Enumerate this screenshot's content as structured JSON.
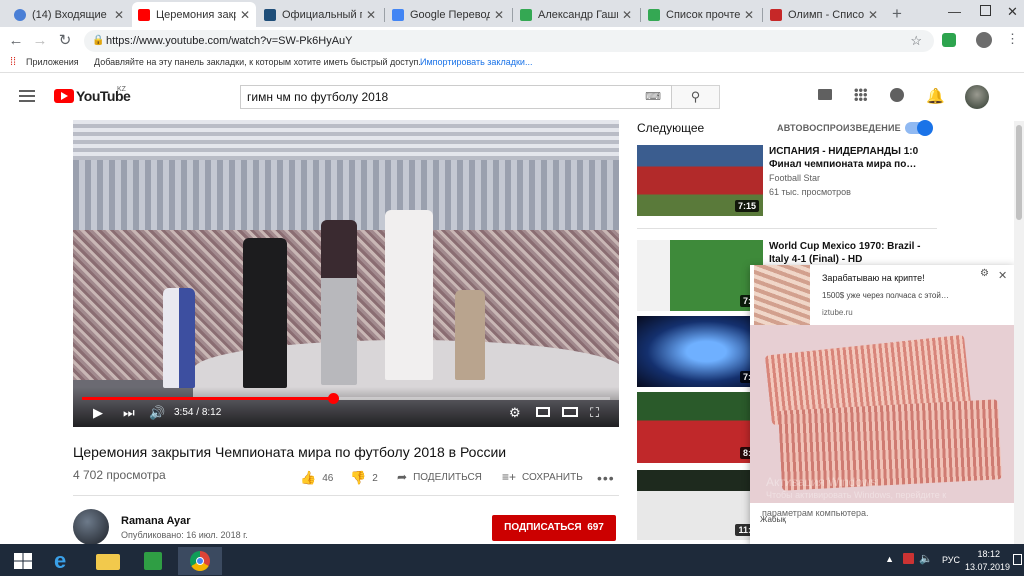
{
  "tabs": [
    {
      "title": "(14) Входящие - П",
      "color": "#d93025"
    },
    {
      "title": "Церемония закры",
      "color": "#ff0000"
    },
    {
      "title": "Официальный гим",
      "color": "#1f4e79"
    },
    {
      "title": "Google Переводчи",
      "color": "#4285f4"
    },
    {
      "title": "Александр Гашин",
      "color": "#34a853"
    },
    {
      "title": "Список прочтени",
      "color": "#34a853"
    },
    {
      "title": "Олимп - Список с",
      "color": "#c62828"
    }
  ],
  "address": {
    "url": "https://www.youtube.com/watch?v=SW-Pk6HyAuY"
  },
  "bookmarks": {
    "apps": "Приложения",
    "hint": "Добавляйте на эту панель закладки, к которым хотите иметь быстрый доступ.",
    "import": "Импортировать закладки..."
  },
  "yt": {
    "logo": "YouTube",
    "region": "KZ",
    "search_value": "гимн чм по футболу 2018"
  },
  "player": {
    "current_time": "3:54",
    "duration": "8:12",
    "progress_fraction": 0.475
  },
  "video": {
    "title": "Церемония закрытия Чемпионата мира по футболу 2018 в России",
    "views": "4 702 просмотра",
    "likes": "46",
    "dislikes": "2",
    "share": "ПОДЕЛИТЬСЯ",
    "save": "СОХРАНИТЬ"
  },
  "channel": {
    "name": "Ramana Ayar",
    "published": "Опубликовано: 16 июл. 2018 г.",
    "subscribe": "ПОДПИСАТЬСЯ",
    "subscribers": "697"
  },
  "sidebar": {
    "up_next": "Следующее",
    "autoplay": "АВТОВОСПРОИЗВЕДЕНИЕ",
    "autoplay_on": true,
    "videos": [
      {
        "title": "ИСПАНИЯ - НИДЕРЛАНДЫ 1:0 Финал чемпионата мира по…",
        "channel": "Football Star",
        "views": "61 тыс. просмотров",
        "duration": "7:15"
      },
      {
        "title": "World Cup Mexico 1970: Brazil - Italy 4-1 (Final) - HD",
        "channel": "",
        "views": "",
        "duration": "7:2"
      },
      {
        "title": "",
        "channel": "",
        "views": "",
        "duration": "7:3"
      },
      {
        "title": "",
        "channel": "",
        "views": "",
        "duration": "8:5"
      },
      {
        "title": "",
        "channel": "",
        "views": "",
        "duration": "11:1"
      }
    ]
  },
  "notification": {
    "title": "Зарабатываю на крипте!",
    "text": "1500$ уже через полчаса с этой…",
    "site": "iztube.ru",
    "overlay_line1": "Активация Windows",
    "overlay_line2": "Чтобы активировать Windows, перейдите к",
    "overlay_line3": "параметрам компьютера.",
    "footer": "Жабық"
  },
  "taskbar": {
    "lang": "РУС",
    "time": "18:12",
    "date": "13.07.2019"
  }
}
